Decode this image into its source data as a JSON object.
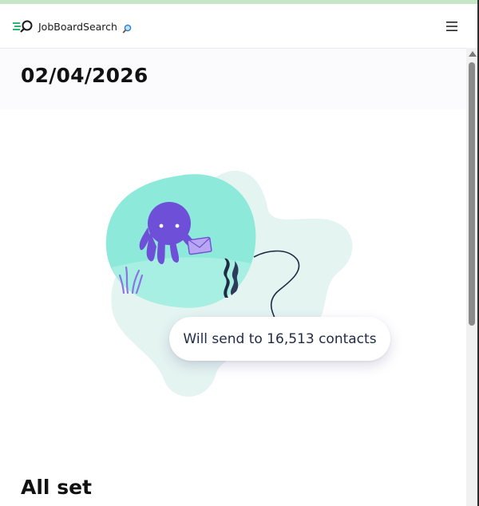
{
  "header": {
    "brand_name": "JobBoardSearch",
    "brand_icon": "magnifier-speed-icon",
    "brand_emoji": "magnifying-glass-icon",
    "menu_icon": "hamburger-menu-icon"
  },
  "main": {
    "date_title": "02/04/2026",
    "send_summary": "Will send to 16,513 contacts",
    "section_title": "All set"
  },
  "colors": {
    "brand_green": "#2bb673",
    "octopus_purple": "#6e4fd8",
    "blob_teal": "#8de9d9",
    "blob_light": "#e4f4f1",
    "text_dark": "#1f2a44"
  }
}
